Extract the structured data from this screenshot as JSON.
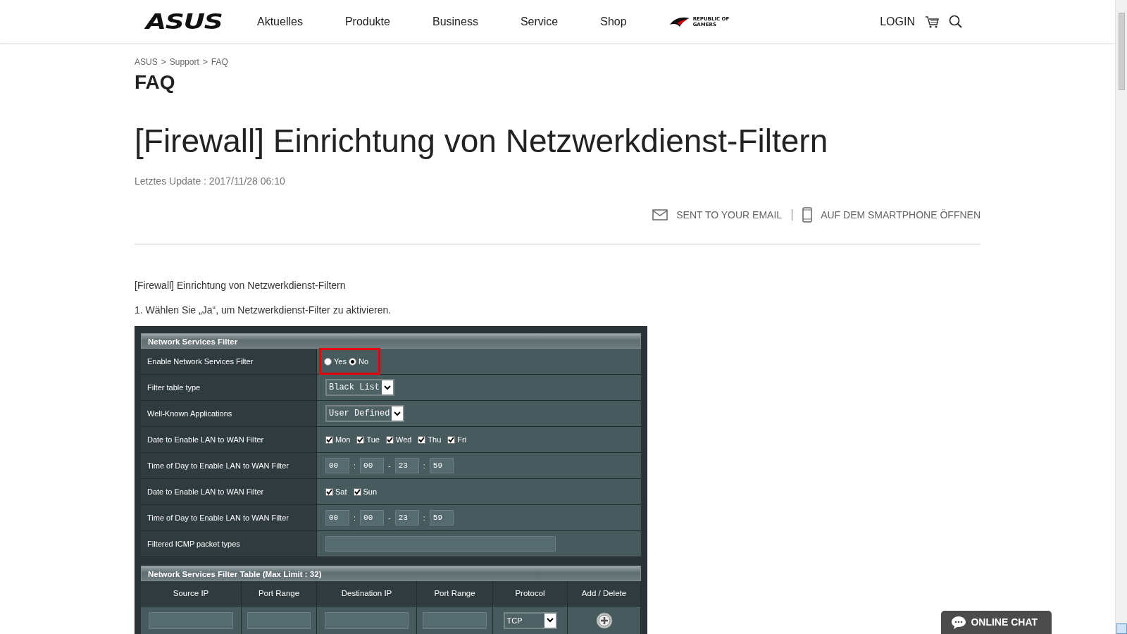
{
  "nav": {
    "logo": "ASUS",
    "items": [
      "Aktuelles",
      "Produkte",
      "Business",
      "Service",
      "Shop"
    ],
    "rog": [
      "REPUBLIC OF",
      "GAMERS"
    ],
    "login": "LOGIN"
  },
  "breadcrumb": {
    "items": [
      "ASUS",
      "Support",
      "FAQ"
    ],
    "separator": ">"
  },
  "section": "FAQ",
  "title": "[Firewall] Einrichtung von Netzwerkdienst-Filtern",
  "updated": "Letztes Update : 2017/11/28 06:10",
  "share": [
    {
      "kind": "email",
      "label": "SENT TO YOUR EMAIL"
    },
    {
      "kind": "phone",
      "label": "AUF DEM SMARTPHONE ÖFFNEN"
    }
  ],
  "intro": "[Firewall] Einrichtung von Netzwerkdienst-Filtern",
  "step": "1. Wählen Sie „Ja“, um Netzwerkdienst-Filter zu aktivieren.",
  "router": {
    "title": "Network Services Filter",
    "rows": [
      {
        "label": "Enable Network Services Filter",
        "kind": "radio",
        "highlighted": true,
        "options": [
          {
            "label": "Yes",
            "selected": false
          },
          {
            "label": "No",
            "selected": true
          }
        ]
      },
      {
        "label": "Filter table type",
        "kind": "select",
        "value": "Black List"
      },
      {
        "label": "Well-Known Applications",
        "kind": "select",
        "value": "User Defined"
      },
      {
        "label": "Date to Enable LAN to WAN Filter",
        "kind": "checkboxes",
        "options": [
          {
            "label": "Mon",
            "checked": true
          },
          {
            "label": "Tue",
            "checked": true
          },
          {
            "label": "Wed",
            "checked": true
          },
          {
            "label": "Thu",
            "checked": true
          },
          {
            "label": "Fri",
            "checked": true
          }
        ]
      },
      {
        "label": "Time of Day to Enable LAN to WAN Filter",
        "kind": "time",
        "values": [
          "00",
          "00",
          "23",
          "59"
        ],
        "separators": [
          ":",
          "-",
          ":"
        ]
      },
      {
        "label": "Date to Enable LAN to WAN Filter",
        "kind": "checkboxes",
        "options": [
          {
            "label": "Sat",
            "checked": true
          },
          {
            "label": "Sun",
            "checked": true
          }
        ]
      },
      {
        "label": "Time of Day to Enable LAN to WAN Filter",
        "kind": "time",
        "values": [
          "00",
          "00",
          "23",
          "59"
        ],
        "separators": [
          ":",
          "-",
          ":"
        ]
      },
      {
        "label": "Filtered ICMP packet types",
        "kind": "text"
      }
    ]
  },
  "filter_table": {
    "title": "Network Services Filter Table (Max Limit : 32)",
    "columns": [
      "Source IP",
      "Port Range",
      "Destination IP",
      "Port Range",
      "Protocol",
      "Add / Delete"
    ],
    "cells": [
      {
        "kind": "input"
      },
      {
        "kind": "input"
      },
      {
        "kind": "input"
      },
      {
        "kind": "input"
      },
      {
        "kind": "select",
        "value": "TCP"
      },
      {
        "kind": "add"
      }
    ]
  },
  "chat": "ONLINE CHAT"
}
